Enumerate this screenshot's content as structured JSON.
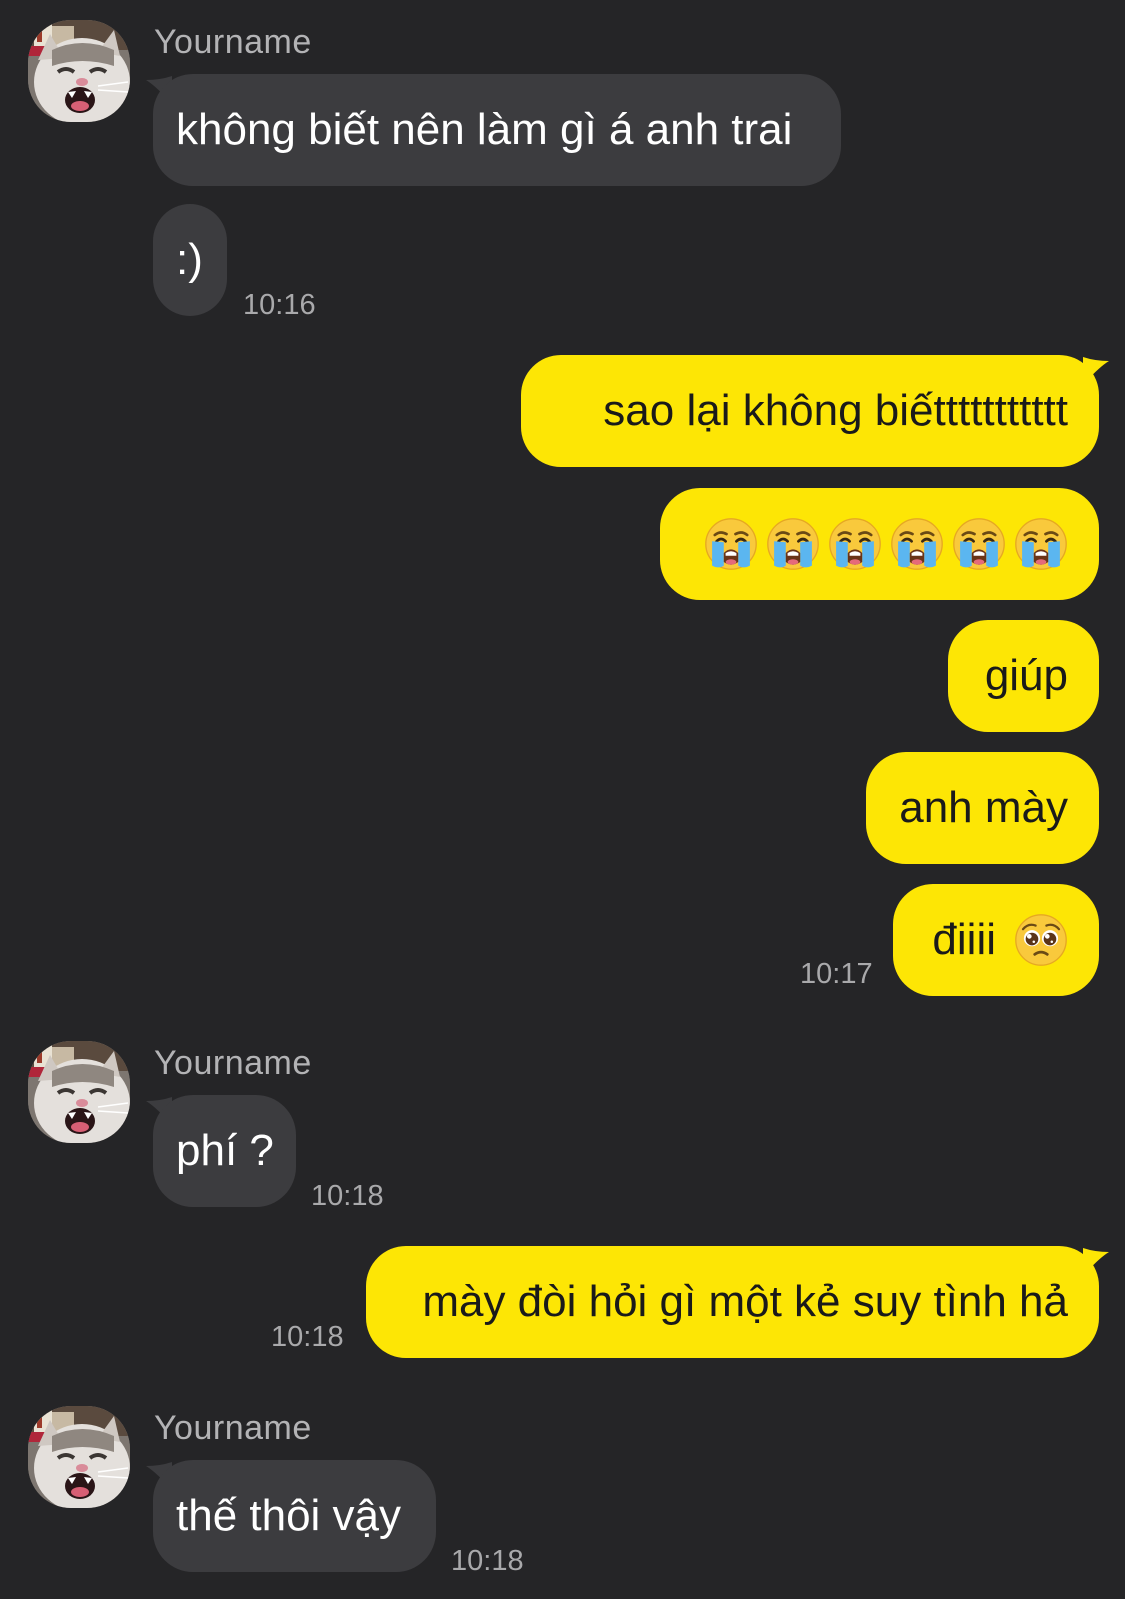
{
  "theme": {
    "background": "#252527",
    "incoming_bubble": "#3c3c3f",
    "outgoing_bubble": "#fde605",
    "timestamp_color": "#a9a9ab",
    "sender_color": "#b3b3b5"
  },
  "conversation": {
    "group1": {
      "sender": "Yourname",
      "avatar_icon": "crying-cat-avatar",
      "msg1": "không biết nên làm gì á anh trai",
      "msg2": ":)",
      "time": "10:16"
    },
    "group2": {
      "msg1": "sao lại không biếttttttttttt",
      "msg2_emoji": [
        "loudly-crying-face",
        "loudly-crying-face",
        "loudly-crying-face",
        "loudly-crying-face",
        "loudly-crying-face",
        "loudly-crying-face"
      ],
      "msg3": "giúp",
      "msg4": "anh mày",
      "msg5": "điiii",
      "msg5_emoji": "pleading-face",
      "time": "10:17"
    },
    "group3": {
      "sender": "Yourname",
      "avatar_icon": "crying-cat-avatar",
      "msg1": "phí ?",
      "time": "10:18"
    },
    "group4": {
      "msg1": "mày đòi hỏi gì một kẻ suy tình hả",
      "time": "10:18"
    },
    "group5": {
      "sender": "Yourname",
      "avatar_icon": "crying-cat-avatar",
      "msg1": "thế thôi vậy",
      "time": "10:18"
    }
  }
}
